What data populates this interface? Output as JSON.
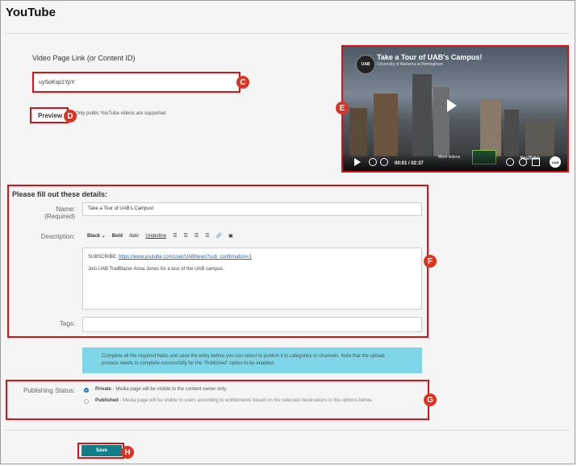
{
  "page": {
    "title": "YouTube"
  },
  "video_link": {
    "label": "Video Page Link (or Content ID)",
    "value": "uySoKsp1YpY"
  },
  "preview": {
    "button_label": "Preview",
    "note": "Only public YouTube videos are supported"
  },
  "video_player": {
    "channel_logo": "UAB",
    "title": "Take a Tour of UAB's Campus!",
    "subtitle": "University of Alabama at Birmingham",
    "time": "00:01 / 02:37",
    "more_videos": "More videos",
    "brand": "YouTube",
    "badge": "UAB"
  },
  "details": {
    "heading": "Please fill out these details:",
    "name_label": "Name:",
    "name_required": "(Required)",
    "name_value": "Take a Tour of UAB's Campus!",
    "description_label": "Description:",
    "toolbar": {
      "color": "Black",
      "bold": "Bold",
      "italic": "Italic",
      "underline": "Underline"
    },
    "description_line1_prefix": "SUBSCRIBE: ",
    "description_link": "https://www.youtube.com/user/UABNews?sub_confirmation=1",
    "description_line2": "Join UAB TrailBlazer Anna Jones for a tour of the UAB campus.",
    "tags_label": "Tags:"
  },
  "info_text": "Complete all the required fields and save the entry before you can select to publish it to categories or channels. Note that the upload process needs to complete successfully for the \"Published\" option to be enabled.",
  "publishing": {
    "label": "Publishing Status:",
    "private_label": "Private",
    "private_desc": " - Media page will be visible to the content owner only.",
    "published_label": "Published",
    "published_desc": " - Media page will be visible to users according to entitlements based on the selected destinations in the options below."
  },
  "save_label": "Save",
  "callouts": [
    "C",
    "D",
    "E",
    "F",
    "G",
    "H"
  ],
  "colors": {
    "callout_red": "#d11",
    "save_teal": "#127e88",
    "info_blue": "#7fd6e8",
    "radio_blue": "#1a6fd6"
  }
}
